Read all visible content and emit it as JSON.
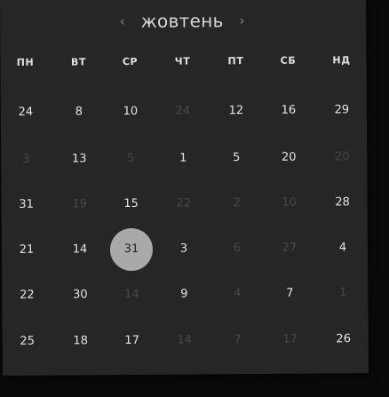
{
  "header": {
    "month": "жовтень",
    "prev_icon": "‹",
    "next_icon": "›"
  },
  "weekdays": [
    "ПН",
    "ВТ",
    "СР",
    "ЧТ",
    "ПТ",
    "СБ",
    "НД"
  ],
  "rows": [
    [
      {
        "label": "24",
        "state": "active"
      },
      {
        "label": "8",
        "state": "active"
      },
      {
        "label": "10",
        "state": "active"
      },
      {
        "label": "24",
        "state": "muted"
      },
      {
        "label": "12",
        "state": "active"
      },
      {
        "label": "16",
        "state": "active"
      },
      {
        "label": "29",
        "state": "active"
      }
    ],
    [
      {
        "label": "3",
        "state": "muted"
      },
      {
        "label": "13",
        "state": "active"
      },
      {
        "label": "5",
        "state": "muted"
      },
      {
        "label": "1",
        "state": "active"
      },
      {
        "label": "5",
        "state": "active"
      },
      {
        "label": "20",
        "state": "active"
      },
      {
        "label": "20",
        "state": "muted"
      }
    ],
    [
      {
        "label": "31",
        "state": "active"
      },
      {
        "label": "19",
        "state": "muted"
      },
      {
        "label": "15",
        "state": "active"
      },
      {
        "label": "22",
        "state": "muted"
      },
      {
        "label": "2",
        "state": "muted"
      },
      {
        "label": "10",
        "state": "muted"
      },
      {
        "label": "28",
        "state": "active"
      }
    ],
    [
      {
        "label": "21",
        "state": "active"
      },
      {
        "label": "14",
        "state": "active"
      },
      {
        "label": "31",
        "state": "selected"
      },
      {
        "label": "3",
        "state": "active"
      },
      {
        "label": "6",
        "state": "muted"
      },
      {
        "label": "27",
        "state": "muted"
      },
      {
        "label": "4",
        "state": "active"
      }
    ],
    [
      {
        "label": "22",
        "state": "active"
      },
      {
        "label": "30",
        "state": "active"
      },
      {
        "label": "14",
        "state": "muted"
      },
      {
        "label": "9",
        "state": "active"
      },
      {
        "label": "4",
        "state": "muted"
      },
      {
        "label": "7",
        "state": "active"
      },
      {
        "label": "1",
        "state": "muted"
      }
    ],
    [
      {
        "label": "25",
        "state": "active"
      },
      {
        "label": "18",
        "state": "active"
      },
      {
        "label": "17",
        "state": "active"
      },
      {
        "label": "14",
        "state": "muted"
      },
      {
        "label": "7",
        "state": "muted"
      },
      {
        "label": "17",
        "state": "muted"
      },
      {
        "label": "26",
        "state": "active"
      }
    ]
  ],
  "colors": {
    "background": "#262626",
    "text": "#e4e4e4",
    "muted_text": "#484848",
    "selected_bg": "#a9a9a9"
  }
}
